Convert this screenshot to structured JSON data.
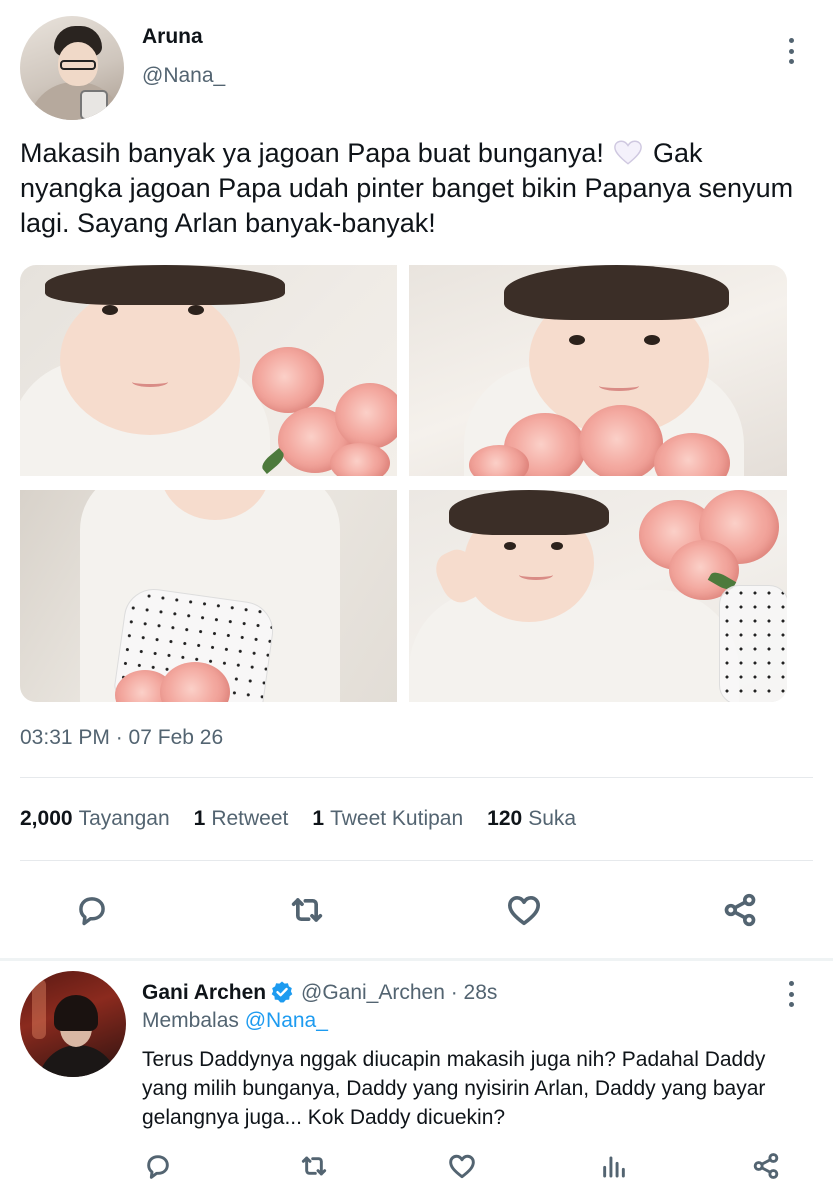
{
  "tweet": {
    "display_name": "Aruna",
    "handle": "@Nana_",
    "text_part1": "Makasih banyak ya jagoan Papa buat bunganya!",
    "text_emoji": "white-heart-emoji",
    "text_part2": "Gak nyangka jagoan Papa udah pinter banget bikin Papanya senyum lagi. Sayang Arlan banyak-banyak!",
    "timestamp": "03:31 PM · 07 Feb 26",
    "stats": {
      "views_count": "2,000",
      "views_label": "Tayangan",
      "retweets_count": "1",
      "retweets_label": "Retweet",
      "quotes_count": "1",
      "quotes_label": "Tweet Kutipan",
      "likes_count": "120",
      "likes_label": "Suka"
    },
    "actions": [
      "reply-icon",
      "retweet-icon",
      "like-icon",
      "share-icon"
    ]
  },
  "reply": {
    "display_name": "Gani Archen",
    "handle_time": "@Gani_Archen · 28s",
    "replying_prefix": "Membalas",
    "replying_to": "@Nana_",
    "text": "Terus Daddynya nggak diucapin makasih juga nih? Padahal Daddy yang milih bunganya, Daddy yang nyisirin Arlan, Daddy yang bayar gelangnya juga... Kok Daddy dicuekin?",
    "actions": [
      "reply-icon",
      "retweet-icon",
      "like-icon",
      "analytics-icon",
      "share-icon"
    ]
  },
  "colors": {
    "text_primary": "#0f1419",
    "text_secondary": "#536471",
    "link": "#1d9bf0",
    "divider": "#e6e9ec"
  }
}
